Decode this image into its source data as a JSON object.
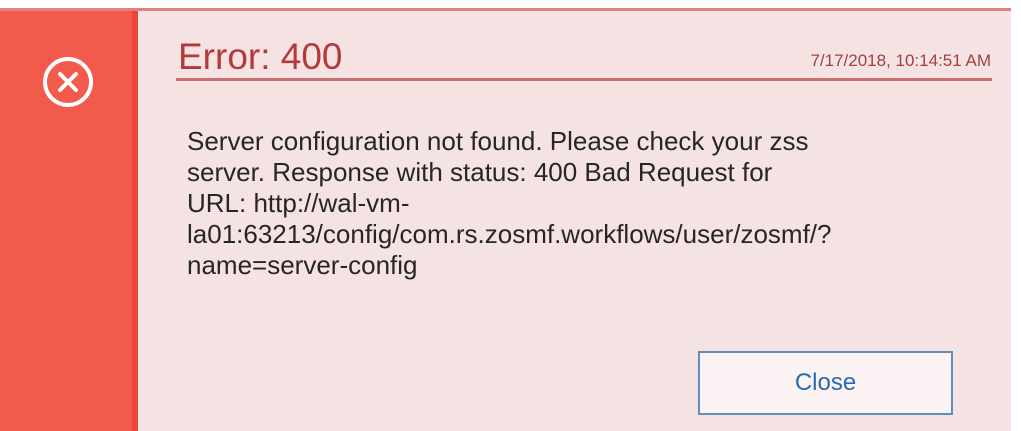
{
  "dialog": {
    "title": "Error: 400",
    "timestamp": "7/17/2018, 10:14:51 AM",
    "message": "Server configuration not found. Please check your zss\nserver. Response with status: 400 Bad Request for\nURL: http://wal-vm-\nla01:63213/config/com.rs.zosmf.workflows/user/zosmf/?\nname=server-config",
    "close_label": "Close",
    "icon": "error-circle-x-icon"
  },
  "colors": {
    "accent_strip": "#f25a4b",
    "background": "#f5e3e3",
    "title": "#b43a3a",
    "button_border": "#5f8fbf",
    "button_text": "#2a6ab0"
  }
}
